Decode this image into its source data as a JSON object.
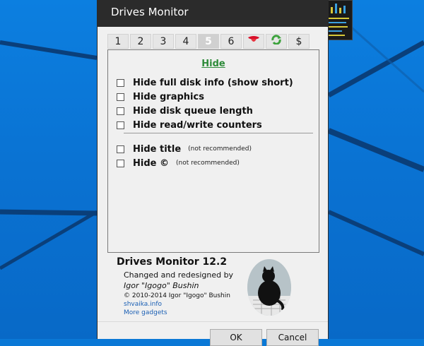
{
  "window": {
    "title": "Drives Monitor"
  },
  "tabs": [
    {
      "label": "1"
    },
    {
      "label": "2"
    },
    {
      "label": "3"
    },
    {
      "label": "4"
    },
    {
      "label": "5"
    },
    {
      "label": "6"
    },
    {
      "label": ""
    },
    {
      "label": ""
    },
    {
      "label": "$"
    }
  ],
  "tab_icons": {
    "tongue": "tongue-icon",
    "refresh": "refresh-icon"
  },
  "panel": {
    "title": "Hide",
    "options": [
      {
        "label": "Hide full disk info (show short)",
        "note": "",
        "checked": false
      },
      {
        "label": "Hide graphics",
        "note": "",
        "checked": false
      },
      {
        "label": "Hide disk queue length",
        "note": "",
        "checked": false
      },
      {
        "label": "Hide read/write counters",
        "note": "",
        "checked": false
      },
      {
        "label": "Hide title",
        "note": "(not recommended)",
        "checked": false
      },
      {
        "label": "Hide ©",
        "note": "(not recommended)",
        "checked": false
      }
    ]
  },
  "about": {
    "name": "Drives Monitor 12.2",
    "line1": "Changed and redesigned by",
    "author": "Igor \"Igogo\" Bushin",
    "copyright": "© 2010-2014 Igor \"Igogo\" Bushin",
    "site": "shvaika.info",
    "more": "More gadgets"
  },
  "buttons": {
    "ok": "OK",
    "cancel": "Cancel"
  },
  "colors": {
    "accent_green": "#2e8b3a",
    "link": "#1a5fb4",
    "titlebar": "#2b2b2b",
    "desktop": "#0a78d6"
  }
}
